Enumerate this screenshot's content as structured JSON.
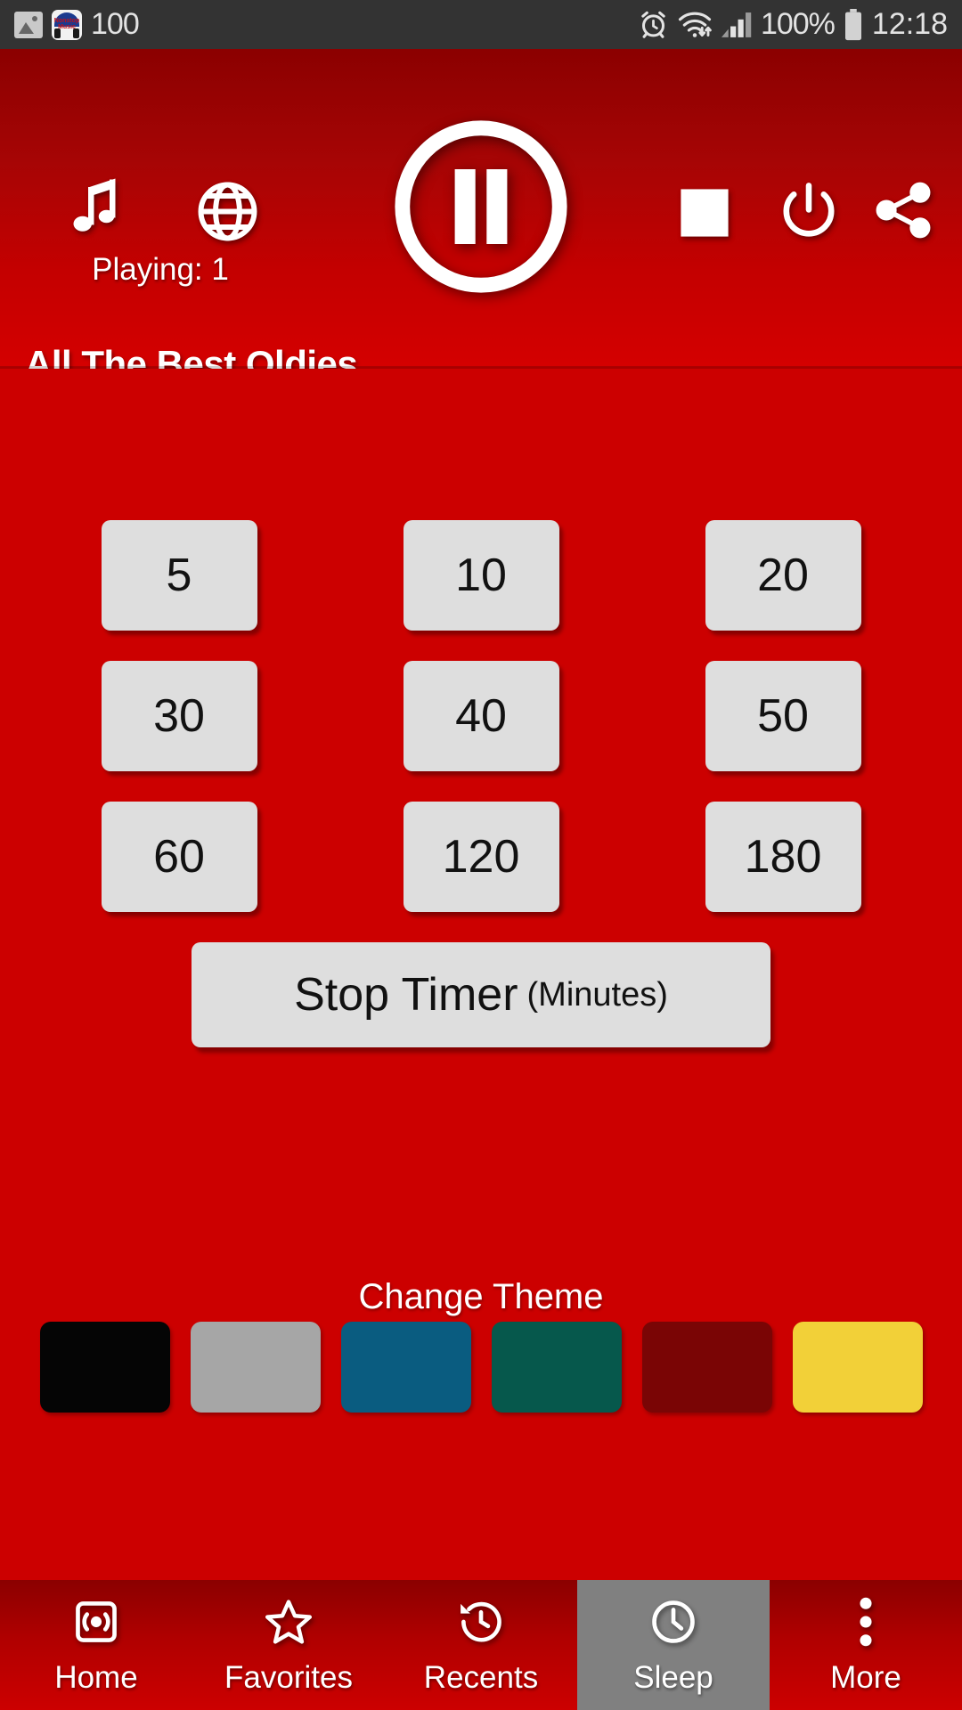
{
  "statusbar": {
    "left_icons": [
      "image-icon",
      "nonstop-music-app-icon"
    ],
    "app_icon_label": "Nonstop Music",
    "notification_count": "100",
    "right_icons": [
      "alarm-icon",
      "wifi-icon",
      "signal-icon"
    ],
    "battery_percent": "100%",
    "clock": "12:18"
  },
  "header": {
    "music_icon": "music-note-icon",
    "globe_icon": "globe-icon",
    "playpause_icon": "pause-icon",
    "stop_icon": "stop-square-icon",
    "power_icon": "power-icon",
    "share_icon": "share-icon",
    "playing_label": "Playing: 1",
    "station_title": "All The Best Oldies"
  },
  "timers": {
    "rows": [
      [
        "5",
        "10",
        "20"
      ],
      [
        "30",
        "40",
        "50"
      ],
      [
        "60",
        "120",
        "180"
      ]
    ],
    "stop_timer_main": "Stop Timer",
    "stop_timer_sub": "(Minutes)"
  },
  "theme": {
    "heading": "Change Theme",
    "swatches": [
      {
        "name": "black",
        "color": "#050505"
      },
      {
        "name": "gray",
        "color": "#A6A6A6"
      },
      {
        "name": "teal-blue",
        "color": "#0A5C80"
      },
      {
        "name": "dark-green",
        "color": "#06584C"
      },
      {
        "name": "dark-red",
        "color": "#7A0505"
      },
      {
        "name": "yellow",
        "color": "#F2D038"
      }
    ]
  },
  "bottomnav": {
    "items": [
      {
        "label": "Home",
        "icon": "radio-icon",
        "active": false
      },
      {
        "label": "Favorites",
        "icon": "star-icon",
        "active": false
      },
      {
        "label": "Recents",
        "icon": "history-clock-icon",
        "active": false
      },
      {
        "label": "Sleep",
        "icon": "clock-icon",
        "active": true
      },
      {
        "label": "More",
        "icon": "overflow-dots-icon",
        "active": false
      }
    ],
    "active_background": "#808080"
  },
  "colors": {
    "background_red": "#CC0000",
    "header_dark_red": "#8B0000",
    "statusbar_gray": "#333333",
    "button_face": "#DEDEDE"
  }
}
